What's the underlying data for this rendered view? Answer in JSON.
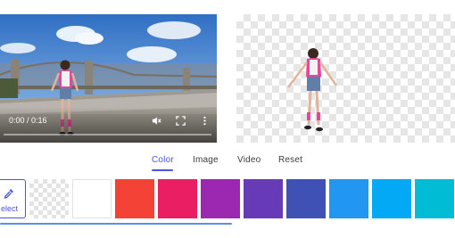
{
  "video": {
    "time_display": "0:00 / 0:16",
    "progress": 0.0,
    "icons": [
      "mute-icon",
      "fullscreen-icon",
      "more-options-icon"
    ]
  },
  "tabs": [
    {
      "label": "Color",
      "active": true
    },
    {
      "label": "Image",
      "active": false
    },
    {
      "label": "Video",
      "active": false
    },
    {
      "label": "Reset",
      "active": false
    }
  ],
  "swatches": {
    "select_label": "elect",
    "select_icon": "eyedropper-icon",
    "colors": [
      "transparent",
      "#ffffff",
      "#f44336",
      "#e91e63",
      "#9c27b0",
      "#673ab7",
      "#3f51b5",
      "#2196f3",
      "#03a9f4",
      "#00bcd4"
    ]
  },
  "accent_color": "#4a56e2"
}
